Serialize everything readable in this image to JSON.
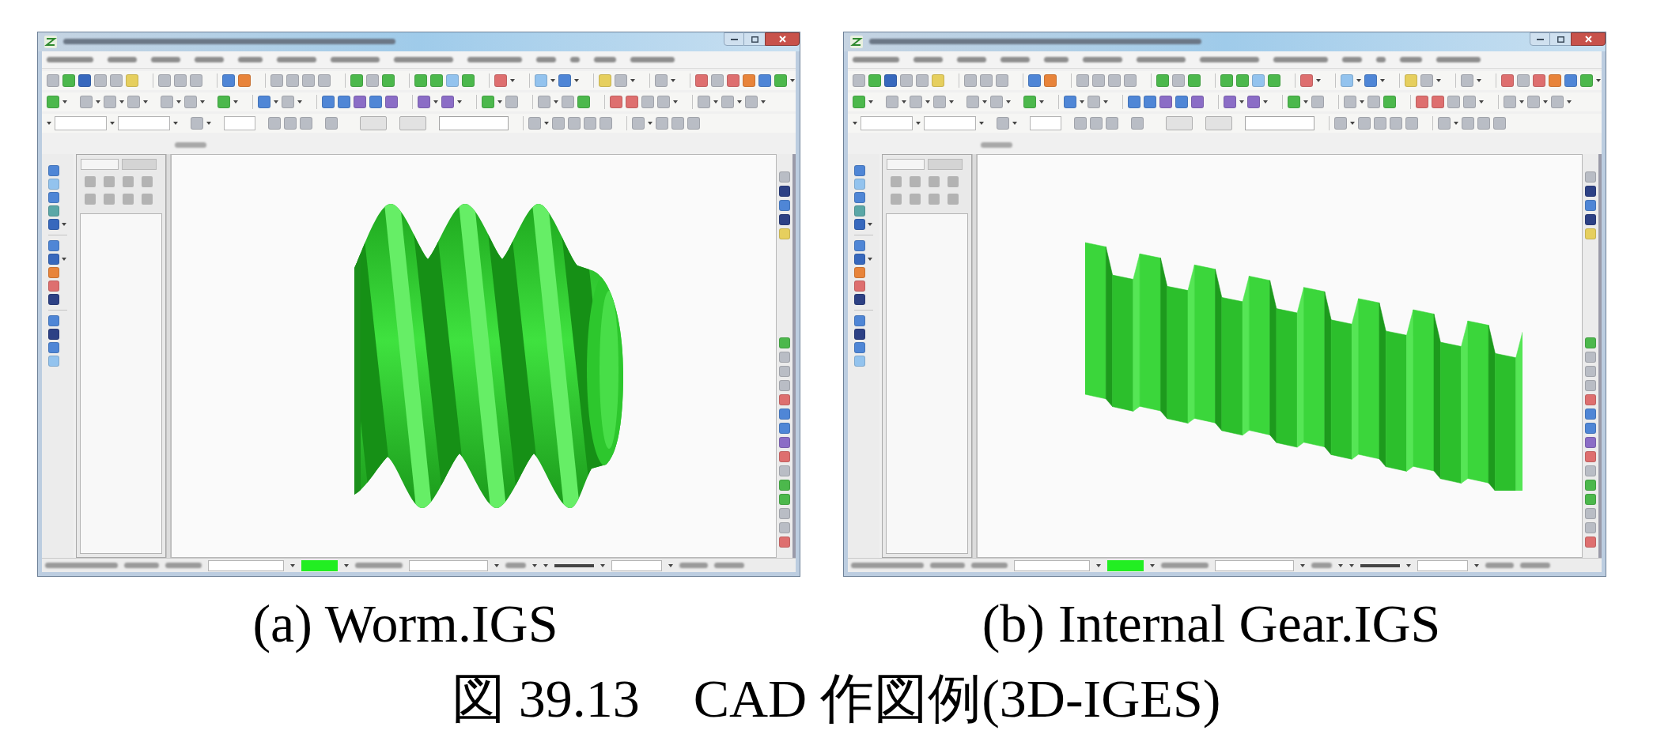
{
  "figure": {
    "panels": [
      {
        "caption": "(a) Worm.IGS",
        "model": {
          "kind": "worm"
        }
      },
      {
        "caption": "(b) Internal Gear.IGS",
        "model": {
          "kind": "gear_segment"
        }
      }
    ],
    "caption": "図 39.13　CAD 作図例(3D-IGES)"
  }
}
